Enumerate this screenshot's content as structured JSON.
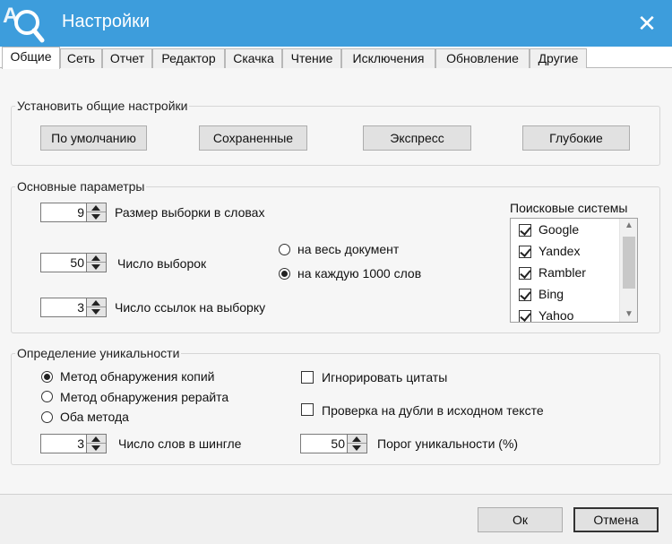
{
  "window": {
    "title": "Настройки",
    "close_label": "✕"
  },
  "tabs": [
    {
      "label": "Общие"
    },
    {
      "label": "Сеть"
    },
    {
      "label": "Отчет"
    },
    {
      "label": "Редактор"
    },
    {
      "label": "Скачка"
    },
    {
      "label": "Чтение"
    },
    {
      "label": "Исключения"
    },
    {
      "label": "Обновление"
    },
    {
      "label": "Другие"
    }
  ],
  "presets": {
    "legend": "Установить общие настройки",
    "buttons": [
      {
        "label": "По умолчанию"
      },
      {
        "label": "Сохраненные"
      },
      {
        "label": "Экспресс"
      },
      {
        "label": "Глубокие"
      }
    ]
  },
  "basic": {
    "legend": "Основные параметры",
    "sample_size": {
      "value": "9",
      "label": "Размер выборки в словах"
    },
    "sample_count": {
      "value": "50",
      "label": "Число выборок"
    },
    "links_per_sample": {
      "value": "3",
      "label": "Число ссылок на выборку"
    },
    "scope_options": [
      {
        "label": "на весь документ",
        "checked": false
      },
      {
        "label": "на каждую 1000 слов",
        "checked": true
      }
    ],
    "search_engines": {
      "title": "Поисковые системы",
      "items": [
        {
          "label": "Google",
          "checked": true
        },
        {
          "label": "Yandex",
          "checked": true
        },
        {
          "label": "Rambler",
          "checked": true
        },
        {
          "label": "Bing",
          "checked": true
        },
        {
          "label": "Yahoo",
          "checked": true
        }
      ]
    }
  },
  "uniqueness": {
    "legend": "Определение уникальности",
    "methods": [
      {
        "label": "Метод обнаружения копий",
        "checked": true
      },
      {
        "label": "Метод обнаружения рерайта",
        "checked": false
      },
      {
        "label": "Оба метода",
        "checked": false
      }
    ],
    "shingle_words": {
      "value": "3",
      "label": "Число слов в шингле"
    },
    "ignore_quotes": {
      "label": "Игнорировать цитаты",
      "checked": false
    },
    "check_duplicates": {
      "label": "Проверка на дубли в исходном тексте",
      "checked": false
    },
    "threshold": {
      "value": "50",
      "label": "Порог уникальности (%)"
    }
  },
  "footer": {
    "ok_label": "Ок",
    "cancel_label": "Отмена"
  },
  "colors": {
    "titlebar": "#3d9ddc",
    "panel": "#f6f6f6"
  }
}
